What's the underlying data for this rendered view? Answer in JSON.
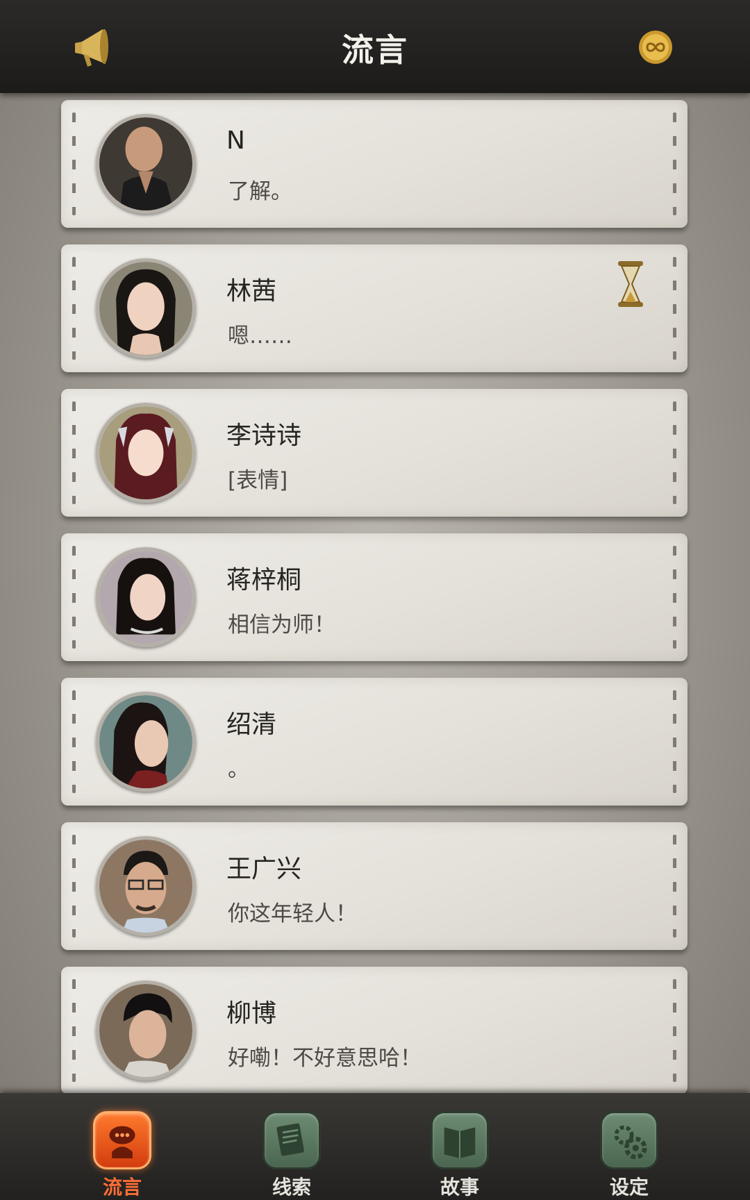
{
  "header": {
    "title": "流言",
    "left_icon": "megaphone-icon",
    "right_icon": "coin-icon"
  },
  "conversations": [
    {
      "name": "N",
      "message": "了解。",
      "pending": false
    },
    {
      "name": "林茜",
      "message": "嗯……",
      "pending": true
    },
    {
      "name": "李诗诗",
      "message": "[表情]",
      "pending": false
    },
    {
      "name": "蒋梓桐",
      "message": "相信为师！",
      "pending": false
    },
    {
      "name": "绍清",
      "message": "。",
      "pending": false
    },
    {
      "name": "王广兴",
      "message": "你这年轻人！",
      "pending": false
    },
    {
      "name": "柳博",
      "message": "好嘞！不好意思哈！",
      "pending": false
    }
  ],
  "nav": {
    "items": [
      {
        "label": "流言",
        "icon": "rumor-chat-icon",
        "active": true
      },
      {
        "label": "线索",
        "icon": "clue-notes-icon",
        "active": false
      },
      {
        "label": "故事",
        "icon": "story-book-icon",
        "active": false
      },
      {
        "label": "设定",
        "icon": "settings-gear-icon",
        "active": false
      }
    ]
  },
  "colors": {
    "header_bg": "#1c1b1a",
    "card_bg": "#e8e5df",
    "active_tab": "#ff6e37",
    "inactive_tab": "#5a7a60"
  }
}
